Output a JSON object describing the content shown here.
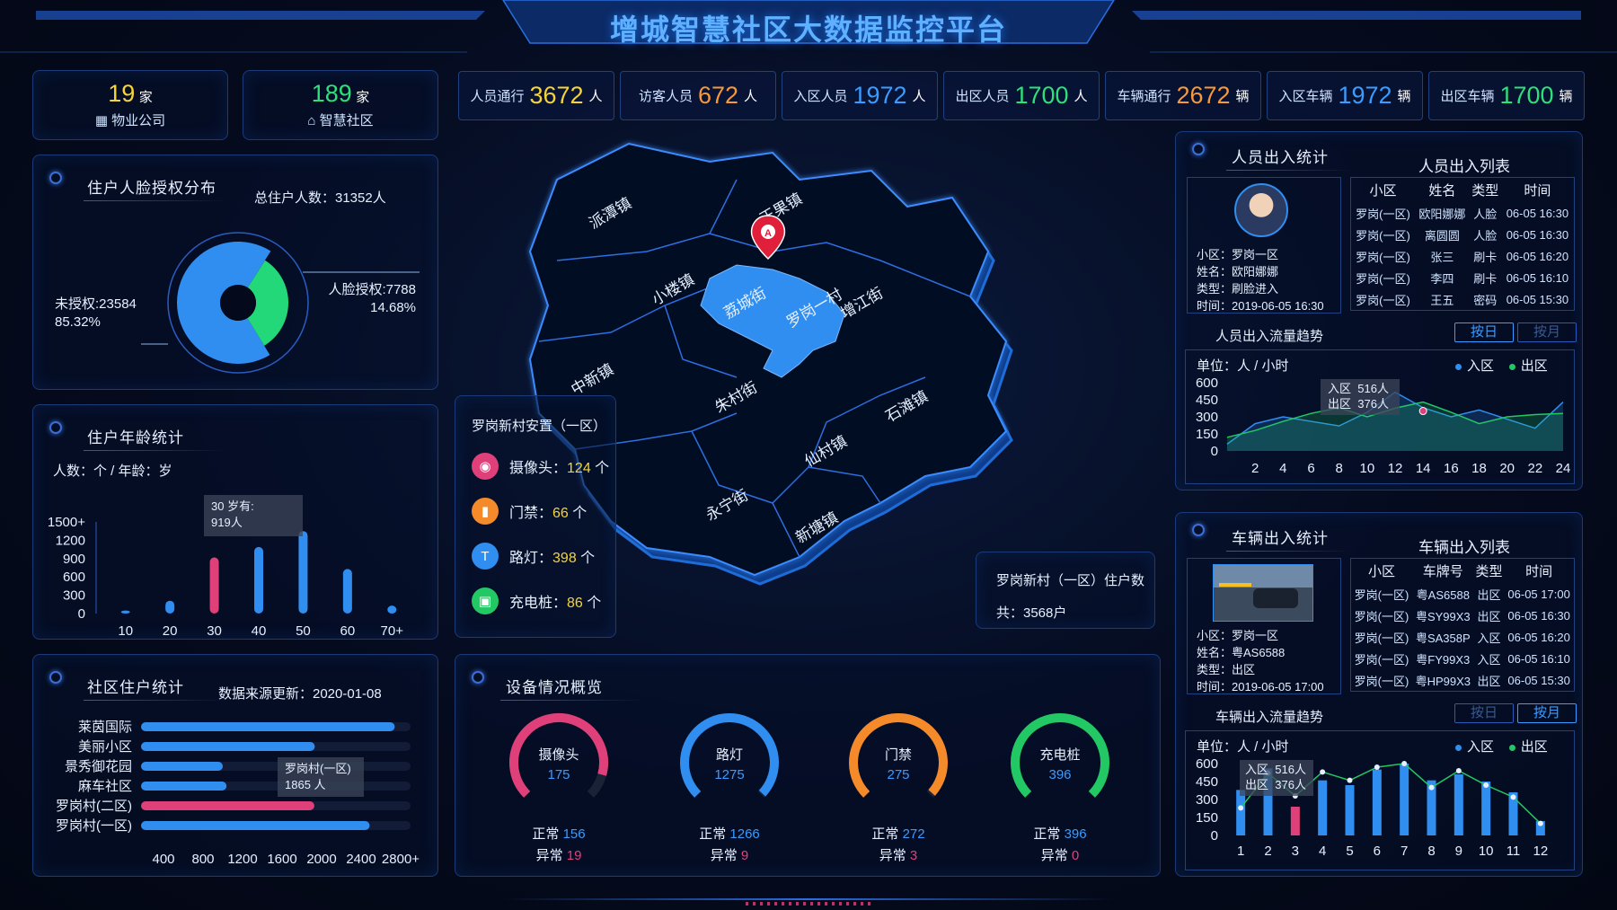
{
  "header": {
    "title": "增城智慧社区大数据监控平台"
  },
  "top_left": {
    "property": {
      "value": "19",
      "unit": "家",
      "label": "物业公司",
      "icon": "building-icon"
    },
    "community": {
      "value": "189",
      "unit": "家",
      "label": "智慧社区",
      "icon": "home-icon"
    }
  },
  "top_stats": [
    {
      "label": "人员通行",
      "value": "3672",
      "unit": "人",
      "color": "#f5d43a"
    },
    {
      "label": "访客人员",
      "value": "672",
      "unit": "人",
      "color": "#f59a3a"
    },
    {
      "label": "入区人员",
      "value": "1972",
      "unit": "人",
      "color": "#3a9cff"
    },
    {
      "label": "出区人员",
      "value": "1700",
      "unit": "人",
      "color": "#2fe07a"
    },
    {
      "label": "车辆通行",
      "value": "2672",
      "unit": "辆",
      "color": "#f59a3a"
    },
    {
      "label": "入区车辆",
      "value": "1972",
      "unit": "辆",
      "color": "#3a9cff"
    },
    {
      "label": "出区车辆",
      "value": "1700",
      "unit": "辆",
      "color": "#2fe07a"
    }
  ],
  "face_auth": {
    "title": "住户人脸授权分布",
    "total": "总住户人数：31352人",
    "unauth_label": "未授权:23584",
    "unauth_pct": "85.32%",
    "auth_label": "人脸授权:7788",
    "auth_pct": "14.68%",
    "unauth_fraction": 0.8532,
    "auth_fraction": 0.1468
  },
  "age_stats": {
    "title": "住户年龄统计",
    "units": "人数：个 / 年龄：岁",
    "tooltip": [
      "30 岁有:",
      "919人"
    ],
    "chart_data": {
      "type": "bar",
      "categories": [
        "10",
        "20",
        "30",
        "40",
        "50",
        "60",
        "70+"
      ],
      "yticks": [
        "1500+",
        "1200",
        "900",
        "600",
        "300",
        "0"
      ],
      "values": [
        50,
        210,
        919,
        1090,
        1350,
        730,
        130
      ],
      "highlight_index": 2,
      "ylim": [
        0,
        1500
      ]
    }
  },
  "community_stats": {
    "title": "社区住户统计",
    "update": "数据来源更新：2020-01-08",
    "tooltip": [
      "罗岗村(一区)",
      "1865 人"
    ],
    "chart_data": {
      "type": "bar",
      "orientation": "horizontal",
      "categories": [
        "莱茵国际",
        "美丽小区",
        "景秀御花园",
        "麻车社区",
        "罗岗村(二区)",
        "罗岗村(一区)"
      ],
      "values": [
        2730,
        1870,
        880,
        920,
        1865,
        2460
      ],
      "highlight_index": 4,
      "xticks": [
        "400",
        "800",
        "1200",
        "1600",
        "2000",
        "2400",
        "2800+"
      ],
      "xlim": [
        0,
        2900
      ]
    }
  },
  "map": {
    "towns": [
      "派潭镇",
      "正果镇",
      "小楼镇",
      "荔城街",
      "罗岗一村",
      "增江街",
      "中新镇",
      "朱村街",
      "石滩镇",
      "仙村镇",
      "永宁街",
      "新塘镇"
    ],
    "marker": "A"
  },
  "resettlement": {
    "title": "罗岗新村安置（一区）",
    "rows": [
      {
        "label": "摄像头：",
        "value": "124",
        "unit": "个",
        "icon": "camera-icon",
        "color": "#e0407a"
      },
      {
        "label": "门禁：",
        "value": "66",
        "unit": "个",
        "icon": "door-icon",
        "color": "#f58a2a"
      },
      {
        "label": "路灯：",
        "value": "398",
        "unit": "个",
        "icon": "streetlight-icon",
        "color": "#2f8ef0"
      },
      {
        "label": "充电桩：",
        "value": "86",
        "unit": "个",
        "icon": "charger-icon",
        "color": "#22c864"
      }
    ]
  },
  "households": {
    "line1": "罗岗新村（一区）住户数",
    "line2": "共：3568户"
  },
  "devices": {
    "title": "设备情况概览",
    "items": [
      {
        "name": "摄像头",
        "total": "175",
        "normal_label": "正常",
        "normal": "156",
        "abnormal_label": "异常",
        "abnormal": "19",
        "color": "#e0407a",
        "fraction": 0.891
      },
      {
        "name": "路灯",
        "total": "1275",
        "normal_label": "正常",
        "normal": "1266",
        "abnormal_label": "异常",
        "abnormal": "9",
        "color": "#2f8ef0",
        "fraction": 0.993
      },
      {
        "name": "门禁",
        "total": "275",
        "normal_label": "正常",
        "normal": "272",
        "abnormal_label": "异常",
        "abnormal": "3",
        "color": "#f58a2a",
        "fraction": 0.989
      },
      {
        "name": "充电桩",
        "total": "396",
        "normal_label": "正常",
        "normal": "396",
        "abnormal_label": "异常",
        "abnormal": "0",
        "color": "#22c864",
        "fraction": 1.0
      }
    ]
  },
  "person_io": {
    "title": "人员出入统计",
    "list_title": "人员出入列表",
    "card": {
      "community": "小区：罗岗一区",
      "name": "姓名：欧阳娜娜",
      "type": "类型：刷脸进入",
      "time": "时间：2019-06-05 16:30"
    },
    "headers": [
      "小区",
      "姓名",
      "类型",
      "时间"
    ],
    "rows": [
      [
        "罗岗(一区)",
        "欧阳娜娜",
        "人脸",
        "06-05 16:30"
      ],
      [
        "罗岗(一区)",
        "离圆圆",
        "人脸",
        "06-05 16:30"
      ],
      [
        "罗岗(一区)",
        "张三",
        "刷卡",
        "06-05 16:20"
      ],
      [
        "罗岗(一区)",
        "李四",
        "刷卡",
        "06-05 16:10"
      ],
      [
        "罗岗(一区)",
        "王五",
        "密码",
        "06-05 15:30"
      ]
    ]
  },
  "person_trend": {
    "title": "人员出入流量趋势",
    "tab_day": "按日",
    "tab_month": "按月",
    "unit": "单位：人 / 小时",
    "legend_in": "入区",
    "legend_out": "出区",
    "tooltip": [
      "入区",
      "516人",
      "出区",
      "376人"
    ],
    "chart_data": {
      "type": "area",
      "x": [
        0,
        2,
        4,
        6,
        8,
        10,
        12,
        14,
        16,
        18,
        20,
        22,
        24
      ],
      "xticks": [
        "2",
        "4",
        "6",
        "8",
        "10",
        "12",
        "14",
        "16",
        "18",
        "20",
        "22",
        "24"
      ],
      "yticks": [
        "600",
        "450",
        "300",
        "150",
        "0"
      ],
      "ylim": [
        0,
        600
      ],
      "series": [
        {
          "name": "入区",
          "values": [
            60,
            240,
            300,
            260,
            220,
            340,
            516,
            380,
            300,
            360,
            280,
            200,
            430
          ],
          "color": "#2f8ef0"
        },
        {
          "name": "出区",
          "values": [
            120,
            180,
            260,
            330,
            380,
            300,
            376,
            430,
            340,
            240,
            300,
            320,
            330
          ],
          "color": "#22c864"
        }
      ]
    }
  },
  "vehicle_io": {
    "title": "车辆出入统计",
    "list_title": "车辆出入列表",
    "card": {
      "community": "小区：罗岗一区",
      "name": "姓名：粤AS6588",
      "type": "类型：出区",
      "time": "时间：2019-06-05 17:00"
    },
    "headers": [
      "小区",
      "车牌号",
      "类型",
      "时间"
    ],
    "rows": [
      [
        "罗岗(一区)",
        "粤AS6588",
        "出区",
        "06-05 17:00"
      ],
      [
        "罗岗(一区)",
        "粤SY99X3",
        "出区",
        "06-05 16:30"
      ],
      [
        "罗岗(一区)",
        "粤SA358P",
        "入区",
        "06-05 16:20"
      ],
      [
        "罗岗(一区)",
        "粤FY99X3",
        "入区",
        "06-05 16:10"
      ],
      [
        "罗岗(一区)",
        "粤HP99X3",
        "出区",
        "06-05 15:30"
      ]
    ]
  },
  "vehicle_trend": {
    "title": "车辆出入流量趋势",
    "tab_day": "按日",
    "tab_month": "按月",
    "unit": "单位：人 / 小时",
    "legend_in": "入区",
    "legend_out": "出区",
    "tooltip": [
      "入区",
      "516人",
      "出区",
      "376人"
    ],
    "chart_data": {
      "type": "bar",
      "categories": [
        "1",
        "2",
        "3",
        "4",
        "5",
        "6",
        "7",
        "8",
        "9",
        "10",
        "11",
        "12"
      ],
      "yticks": [
        "600",
        "450",
        "300",
        "150",
        "0"
      ],
      "ylim": [
        0,
        600
      ],
      "highlight_index": 2,
      "series": [
        {
          "name": "入区",
          "values": [
            380,
            560,
            240,
            460,
            420,
            550,
            600,
            460,
            510,
            450,
            360,
            120
          ],
          "color": "#2f8ef0"
        },
        {
          "name": "出区",
          "values": [
            230,
            520,
            330,
            530,
            460,
            570,
            620,
            400,
            540,
            420,
            320,
            100
          ],
          "color": "#22c864"
        }
      ]
    }
  },
  "colors": {
    "accent": "#2f8ef0",
    "highlight": "#e0407a",
    "green": "#22c864",
    "orange": "#f58a2a",
    "yellow": "#f5d43a"
  }
}
